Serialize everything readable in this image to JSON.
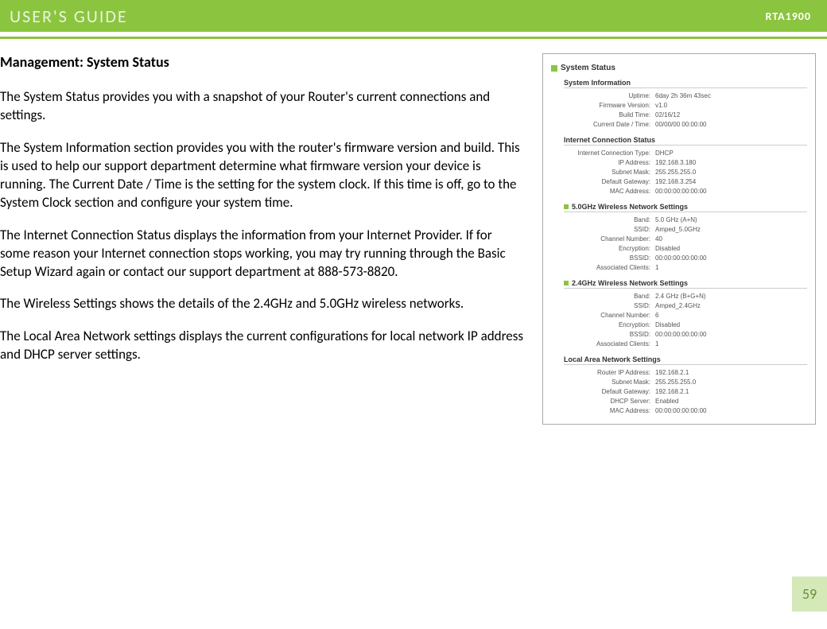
{
  "header": {
    "title": "USER'S GUIDE",
    "model": "RTA1900"
  },
  "page": {
    "heading": "Management: System Status",
    "para1": "The System Status provides you with a snapshot of your Router's current connections and settings.",
    "para2": "The System Information section provides you with the router's firmware version and build.  This is used to help our support department determine what firmware version your device is running.  The Current Date / Time is the setting for the system clock.  If this time is off, go to the System Clock section and configure your system time.",
    "para3": "The Internet Connection Status displays the information from your Internet Provider.  If for some reason your Internet connection stops working, you may try running through the Basic Setup Wizard again or contact our support department at 888-573-8820.",
    "para4": "The Wireless Settings shows the details of the 2.4GHz and 5.0GHz wireless networks.",
    "para5": "The Local Area Network settings displays the current configurations for local network IP address and DHCP server settings.",
    "number": "59"
  },
  "figure": {
    "title": "System Status",
    "sections": {
      "sysinfo": {
        "heading": "System Information",
        "uptime_l": "Uptime:",
        "uptime_v": "6day 2h 36m 43sec",
        "fw_l": "Firmware Version:",
        "fw_v": "v1.0",
        "build_l": "Build Time:",
        "build_v": "02/16/12",
        "date_l": "Current Date / Time:",
        "date_v": "00/00/00 00:00:00"
      },
      "inet": {
        "heading": "Internet Connection Status",
        "type_l": "Internet Connection Type:",
        "type_v": "DHCP",
        "ip_l": "IP Address:",
        "ip_v": "192.168.3.180",
        "mask_l": "Subnet Mask:",
        "mask_v": "255.255.255.0",
        "gw_l": "Default Gateway:",
        "gw_v": "192.168.3.254",
        "mac_l": "MAC Address:",
        "mac_v": "00:00:00:00:00:00"
      },
      "w5": {
        "heading": "5.0GHz Wireless Network Settings",
        "band_l": "Band:",
        "band_v": "5.0 GHz (A+N)",
        "ssid_l": "SSID:",
        "ssid_v": "Amped_5.0GHz",
        "ch_l": "Channel Number:",
        "ch_v": "40",
        "enc_l": "Encryption:",
        "enc_v": "Disabled",
        "bssid_l": "BSSID:",
        "bssid_v": "00:00:00:00:00:00",
        "cl_l": "Associated Clients:",
        "cl_v": "1"
      },
      "w24": {
        "heading": "2.4GHz Wireless Network Settings",
        "band_l": "Band:",
        "band_v": "2.4 GHz (B+G+N)",
        "ssid_l": "SSID:",
        "ssid_v": "Amped_2.4GHz",
        "ch_l": "Channel Number:",
        "ch_v": "6",
        "enc_l": "Encryption:",
        "enc_v": "Disabled",
        "bssid_l": "BSSID:",
        "bssid_v": "00:00:00:00:00:00",
        "cl_l": "Associated Clients:",
        "cl_v": "1"
      },
      "lan": {
        "heading": "Local Area Network Settings",
        "ip_l": "Router IP Address:",
        "ip_v": "192.168.2.1",
        "mask_l": "Subnet Mask:",
        "mask_v": "255.255.255.0",
        "gw_l": "Default Gateway:",
        "gw_v": "192.168.2.1",
        "dhcp_l": "DHCP Server:",
        "dhcp_v": "Enabled",
        "mac_l": "MAC Address:",
        "mac_v": "00:00:00:00:00:00"
      }
    }
  }
}
